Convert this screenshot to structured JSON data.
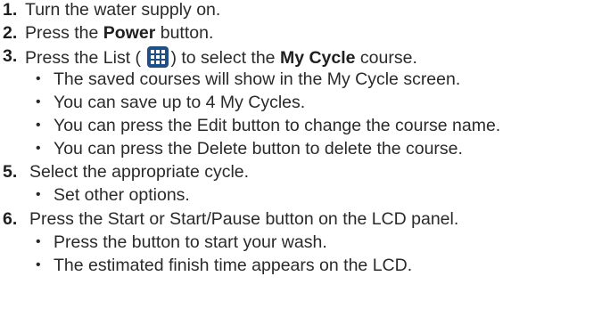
{
  "steps": [
    {
      "num": "1.",
      "pre": "Turn the water supply on."
    },
    {
      "num": "2.",
      "pre": "Press the ",
      "bold": "Power",
      "post": " button."
    },
    {
      "num": "3.",
      "pre": "Press the List (",
      "mid": ") to select the ",
      "bold": "My Cycle",
      "post": " course.",
      "icon": "list-grid-icon"
    },
    {
      "num": "5.",
      "pre": "Select the appropriate cycle."
    },
    {
      "num": "6.",
      "pre": "Press the Start or Start/Pause button on the LCD panel."
    }
  ],
  "bullets": {
    "step3": [
      "The saved courses will show in the My Cycle screen.",
      "You can save up to 4 My Cycles.",
      "You can press the Edit button to change the course name.",
      "You can press the Delete button to delete the course."
    ],
    "step5": [
      "Set other options."
    ],
    "step6": [
      "Press the button to start your wash.",
      "The estimated finish time appears on the LCD."
    ]
  },
  "bullet_glyph": "•",
  "colors": {
    "icon_bg": "#1f4f86",
    "text": "#2a2a2a"
  }
}
